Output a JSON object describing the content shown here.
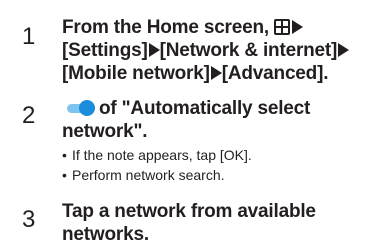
{
  "steps": [
    {
      "number": "1",
      "line1_prefix": "From the Home screen,",
      "line1_suffix": "",
      "line2": "[Settings]",
      "line2_b": "[Network & internet]",
      "line3": "[Mobile network]",
      "line3_b": "[Advanced]."
    },
    {
      "number": "2",
      "line1": "of \"Automatically select",
      "line2": "network\".",
      "bullets": [
        "If the note appears, tap [OK].",
        "Perform network search."
      ]
    },
    {
      "number": "3",
      "line1": "Tap a network from available",
      "line2": "networks."
    }
  ],
  "icons": {
    "apps": "apps-grid-icon",
    "arrow": "right-arrow-icon",
    "toggle": "toggle-switch-on-icon"
  },
  "colors": {
    "text": "#231f20",
    "toggle_track": "#7fc4ee",
    "toggle_knob": "#1a8cdb"
  }
}
